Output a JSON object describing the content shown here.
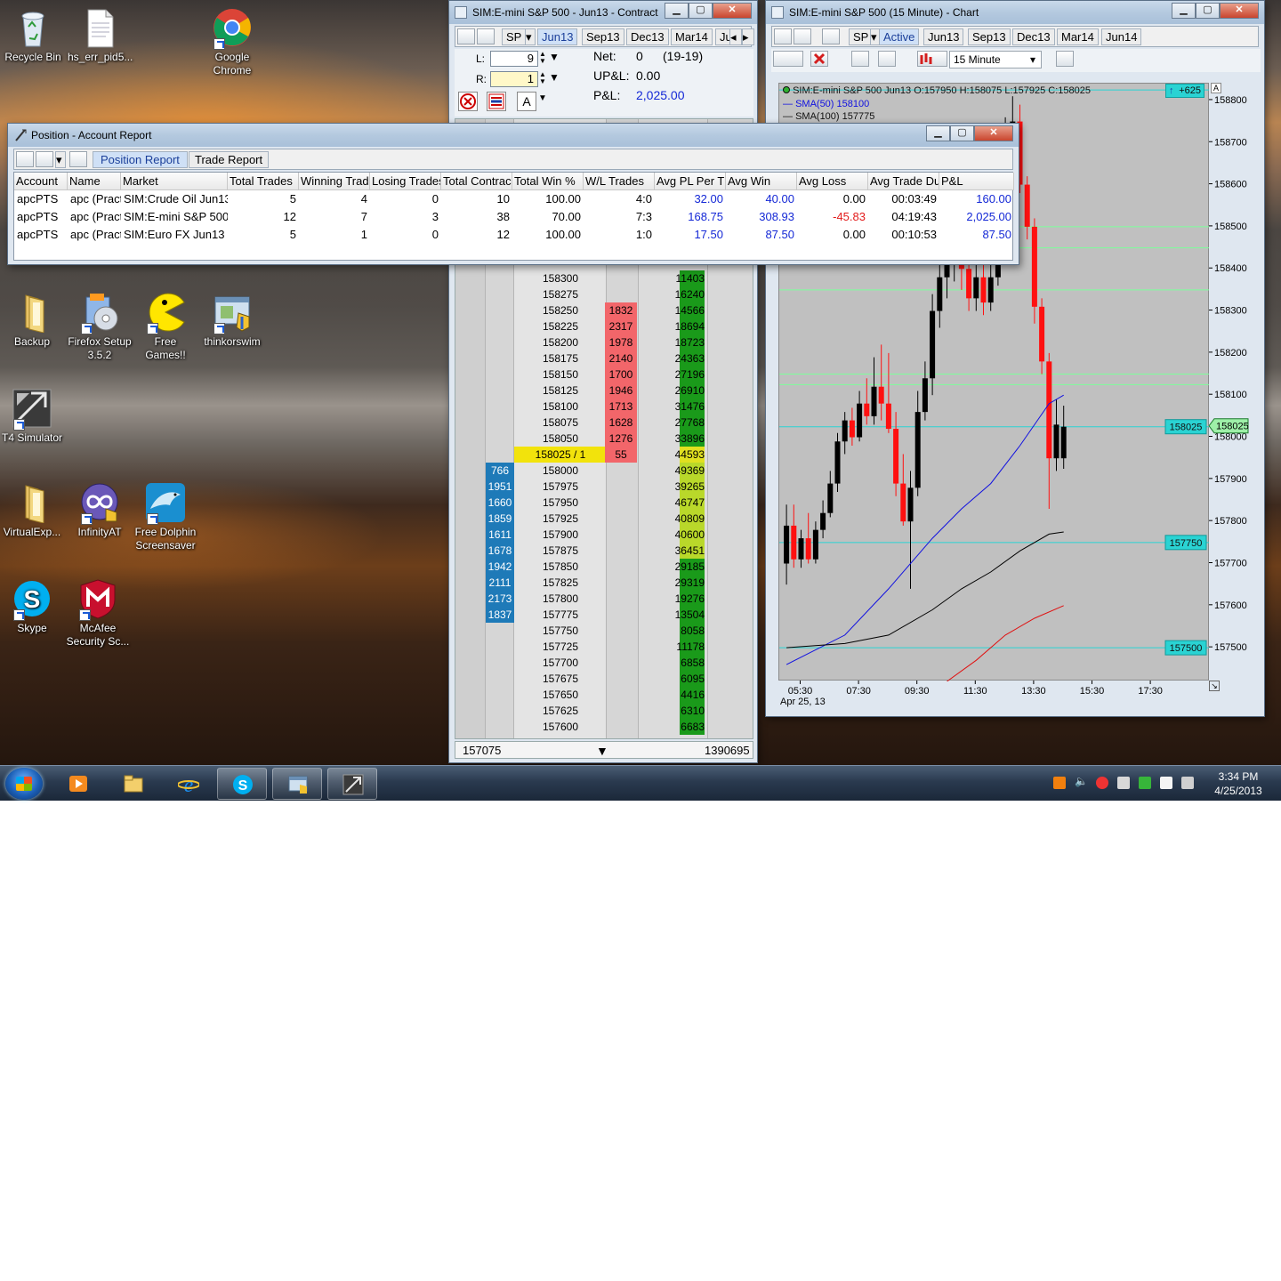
{
  "desktop": {
    "icons": [
      {
        "label": "Recycle Bin",
        "icon": "recycle-bin-icon"
      },
      {
        "label": "hs_err_pid5...",
        "icon": "text-file-icon"
      },
      {
        "label": "Google\nChrome",
        "icon": "chrome-icon"
      },
      {
        "label": "Backup",
        "icon": "folder-icon"
      },
      {
        "label": "Firefox Setup\n3.5.2",
        "icon": "installer-icon"
      },
      {
        "label": "Free Games!!",
        "icon": "pacman-icon"
      },
      {
        "label": "thinkorswim",
        "icon": "app-window-icon"
      },
      {
        "label": "T4 Simulator",
        "icon": "t4-icon"
      },
      {
        "label": "VirtualExp...",
        "icon": "folder-icon"
      },
      {
        "label": "InfinityAT",
        "icon": "infinity-icon"
      },
      {
        "label": "Free Dolphin\nScreensaver",
        "icon": "dolphin-icon"
      },
      {
        "label": "Skype",
        "icon": "skype-icon"
      },
      {
        "label": "McAfee\nSecurity Sc...",
        "icon": "mcafee-icon"
      }
    ]
  },
  "taskbar": {
    "apps": [
      "media-player-icon",
      "file-explorer-icon",
      "internet-explorer-icon",
      "skype-icon",
      "thinkorswim-icon",
      "t4-icon"
    ],
    "clock_time": "3:34 PM",
    "clock_date": "4/25/2013"
  },
  "contract_window": {
    "title": "SIM:E-mini S&P 500 - Jun13 - Contract",
    "symbol": "SP",
    "tabs": [
      "Jun13",
      "Sep13",
      "Dec13",
      "Mar14",
      "Ju"
    ],
    "selected_tab": "Jun13",
    "l_label": "L:",
    "l_value": "9",
    "r_label": "R:",
    "r_value": "1",
    "net_label": "Net:",
    "net_value": "0",
    "net_range": "(19-19)",
    "upl_label": "UP&L:",
    "upl_value": "0.00",
    "pl_label": "P&L:",
    "pl_value": "2,025.00",
    "footer_left": "157075",
    "footer_right": "1390695",
    "ladder": [
      {
        "price": "158300",
        "bid": "",
        "ask": "",
        "vol": "11403"
      },
      {
        "price": "158275",
        "bid": "",
        "ask": "",
        "vol": "16240"
      },
      {
        "price": "158250",
        "bid": "",
        "ask": "1832",
        "vol": "14566"
      },
      {
        "price": "158225",
        "bid": "",
        "ask": "2317",
        "vol": "18694"
      },
      {
        "price": "158200",
        "bid": "",
        "ask": "1978",
        "vol": "18723"
      },
      {
        "price": "158175",
        "bid": "",
        "ask": "2140",
        "vol": "24363"
      },
      {
        "price": "158150",
        "bid": "",
        "ask": "1700",
        "vol": "27196"
      },
      {
        "price": "158125",
        "bid": "",
        "ask": "1946",
        "vol": "26910"
      },
      {
        "price": "158100",
        "bid": "",
        "ask": "1713",
        "vol": "31476"
      },
      {
        "price": "158075",
        "bid": "",
        "ask": "1628",
        "vol": "27768"
      },
      {
        "price": "158050",
        "bid": "",
        "ask": "1276",
        "vol": "33896"
      },
      {
        "price": "158025 / 1",
        "bid": "",
        "ask": "55",
        "vol": "44593",
        "current": true
      },
      {
        "price": "158000",
        "bid": "766",
        "ask": "",
        "vol": "49369"
      },
      {
        "price": "157975",
        "bid": "1951",
        "ask": "",
        "vol": "39265"
      },
      {
        "price": "157950",
        "bid": "1660",
        "ask": "",
        "vol": "46747"
      },
      {
        "price": "157925",
        "bid": "1859",
        "ask": "",
        "vol": "40809"
      },
      {
        "price": "157900",
        "bid": "1611",
        "ask": "",
        "vol": "40600"
      },
      {
        "price": "157875",
        "bid": "1678",
        "ask": "",
        "vol": "36451"
      },
      {
        "price": "157850",
        "bid": "1942",
        "ask": "",
        "vol": "29185"
      },
      {
        "price": "157825",
        "bid": "2111",
        "ask": "",
        "vol": "29319"
      },
      {
        "price": "157800",
        "bid": "2173",
        "ask": "",
        "vol": "19276"
      },
      {
        "price": "157775",
        "bid": "1837",
        "ask": "",
        "vol": "13504"
      },
      {
        "price": "157750",
        "bid": "",
        "ask": "",
        "vol": "8058"
      },
      {
        "price": "157725",
        "bid": "",
        "ask": "",
        "vol": "11178"
      },
      {
        "price": "157700",
        "bid": "",
        "ask": "",
        "vol": "6858"
      },
      {
        "price": "157675",
        "bid": "",
        "ask": "",
        "vol": "6095"
      },
      {
        "price": "157650",
        "bid": "",
        "ask": "",
        "vol": "4416"
      },
      {
        "price": "157625",
        "bid": "",
        "ask": "",
        "vol": "6310"
      },
      {
        "price": "157600",
        "bid": "",
        "ask": "",
        "vol": "6683"
      }
    ]
  },
  "chart_window": {
    "title": "SIM:E-mini S&P 500 (15 Minute) - Chart",
    "symbol": "SP",
    "tabs": [
      "Active",
      "Jun13",
      "Sep13",
      "Dec13",
      "Mar14",
      "Jun14"
    ],
    "selected_tab": "Active",
    "interval": "15 Minute",
    "ohlc_label": "SIM:E-mini S&P 500 Jun13 O:157950 H:158075 L:157925 C:158025",
    "sma50_label": "SMA(50)  158100",
    "sma100_label": "SMA(100)  157775",
    "top_badge": "+625",
    "price_badges": [
      "158025",
      "157750",
      "157500"
    ],
    "current_price_tag": "158025",
    "date_label": "Apr 25, 13",
    "colors": {
      "up": "#000000",
      "down": "#ff1010",
      "sma50": "#1010e0",
      "sma100": "#000000",
      "sma200": "#e01010",
      "levels": "#7dff9a",
      "badge": "#2ad3d3"
    }
  },
  "chart_data": {
    "type": "candlestick",
    "x_ticks": [
      "05:30",
      "07:30",
      "09:30",
      "11:30",
      "13:30",
      "15:30",
      "17:30"
    ],
    "y_ticks": [
      "158800",
      "158700",
      "158600",
      "158500",
      "158400",
      "158300",
      "158200",
      "158100",
      "158000",
      "157900",
      "157800",
      "157700",
      "157600",
      "157500"
    ],
    "ylim": [
      157420,
      158840
    ],
    "x_start_time": "05:00",
    "bar_minutes": 15,
    "candles": [
      {
        "o": 157700,
        "h": 157840,
        "l": 157650,
        "c": 157790
      },
      {
        "o": 157790,
        "h": 157840,
        "l": 157690,
        "c": 157710
      },
      {
        "o": 157710,
        "h": 157780,
        "l": 157690,
        "c": 157760
      },
      {
        "o": 157760,
        "h": 157820,
        "l": 157700,
        "c": 157710
      },
      {
        "o": 157710,
        "h": 157800,
        "l": 157700,
        "c": 157780
      },
      {
        "o": 157780,
        "h": 157850,
        "l": 157760,
        "c": 157820
      },
      {
        "o": 157820,
        "h": 157920,
        "l": 157810,
        "c": 157890
      },
      {
        "o": 157890,
        "h": 158010,
        "l": 157870,
        "c": 157990
      },
      {
        "o": 157990,
        "h": 158060,
        "l": 157960,
        "c": 158040
      },
      {
        "o": 158040,
        "h": 158070,
        "l": 157980,
        "c": 158000
      },
      {
        "o": 158000,
        "h": 158110,
        "l": 157990,
        "c": 158080
      },
      {
        "o": 158080,
        "h": 158140,
        "l": 158030,
        "c": 158050
      },
      {
        "o": 158050,
        "h": 158190,
        "l": 158030,
        "c": 158120
      },
      {
        "o": 158120,
        "h": 158220,
        "l": 158040,
        "c": 158080
      },
      {
        "o": 158080,
        "h": 158200,
        "l": 158010,
        "c": 158020
      },
      {
        "o": 158020,
        "h": 158060,
        "l": 157860,
        "c": 157890
      },
      {
        "o": 157890,
        "h": 157960,
        "l": 157790,
        "c": 157800
      },
      {
        "o": 157800,
        "h": 157920,
        "l": 157640,
        "c": 157880
      },
      {
        "o": 157880,
        "h": 158110,
        "l": 157860,
        "c": 158060
      },
      {
        "o": 158060,
        "h": 158180,
        "l": 158040,
        "c": 158140
      },
      {
        "o": 158140,
        "h": 158340,
        "l": 158100,
        "c": 158300
      },
      {
        "o": 158300,
        "h": 158420,
        "l": 158260,
        "c": 158380
      },
      {
        "o": 158380,
        "h": 158450,
        "l": 158330,
        "c": 158410
      },
      {
        "o": 158410,
        "h": 158460,
        "l": 158370,
        "c": 158420
      },
      {
        "o": 158420,
        "h": 158440,
        "l": 158350,
        "c": 158400
      },
      {
        "o": 158400,
        "h": 158440,
        "l": 158300,
        "c": 158330
      },
      {
        "o": 158330,
        "h": 158420,
        "l": 158300,
        "c": 158380
      },
      {
        "o": 158380,
        "h": 158430,
        "l": 158290,
        "c": 158320
      },
      {
        "o": 158320,
        "h": 158420,
        "l": 158300,
        "c": 158380
      },
      {
        "o": 158380,
        "h": 158650,
        "l": 158360,
        "c": 158620
      },
      {
        "o": 158620,
        "h": 158760,
        "l": 158580,
        "c": 158700
      },
      {
        "o": 158700,
        "h": 158810,
        "l": 158650,
        "c": 158750
      },
      {
        "o": 158750,
        "h": 158790,
        "l": 158580,
        "c": 158600
      },
      {
        "o": 158600,
        "h": 158620,
        "l": 158470,
        "c": 158500
      },
      {
        "o": 158500,
        "h": 158520,
        "l": 158270,
        "c": 158310
      },
      {
        "o": 158310,
        "h": 158330,
        "l": 158150,
        "c": 158180
      },
      {
        "o": 158180,
        "h": 158200,
        "l": 157830,
        "c": 157950
      },
      {
        "o": 157950,
        "h": 158090,
        "l": 157920,
        "c": 158030
      },
      {
        "o": 157950,
        "h": 158075,
        "l": 157925,
        "c": 158025
      }
    ],
    "series": [
      {
        "name": "SMA(50)",
        "color": "#1010e0",
        "values": [
          [
            0,
            157460
          ],
          [
            8,
            157530
          ],
          [
            14,
            157640
          ],
          [
            20,
            157760
          ],
          [
            24,
            157830
          ],
          [
            28,
            157890
          ],
          [
            32,
            157980
          ],
          [
            36,
            158080
          ],
          [
            38,
            158100
          ]
        ]
      },
      {
        "name": "SMA(100)",
        "color": "#000000",
        "values": [
          [
            0,
            157500
          ],
          [
            8,
            157510
          ],
          [
            14,
            157530
          ],
          [
            20,
            157590
          ],
          [
            24,
            157640
          ],
          [
            28,
            157680
          ],
          [
            32,
            157730
          ],
          [
            36,
            157770
          ],
          [
            38,
            157775
          ]
        ]
      },
      {
        "name": "SMA(200)",
        "color": "#e01010",
        "values": [
          [
            22,
            157420
          ],
          [
            26,
            157470
          ],
          [
            30,
            157530
          ],
          [
            34,
            157570
          ],
          [
            38,
            157600
          ]
        ]
      }
    ],
    "horizontal_lines": [
      {
        "y": 158825,
        "color": "#2ad3d3"
      },
      {
        "y": 158500,
        "color": "#7dff9a"
      },
      {
        "y": 158450,
        "color": "#7dff9a"
      },
      {
        "y": 158350,
        "color": "#7dff9a"
      },
      {
        "y": 158150,
        "color": "#7dff9a"
      },
      {
        "y": 158125,
        "color": "#7dff9a"
      },
      {
        "y": 158025,
        "color": "#2ad3d3"
      },
      {
        "y": 157750,
        "color": "#2ad3d3"
      },
      {
        "y": 157500,
        "color": "#2ad3d3"
      }
    ]
  },
  "report_window": {
    "title": "Position - Account Report",
    "tabs": [
      "Position Report",
      "Trade Report"
    ],
    "selected_tab": "Position Report",
    "columns": [
      "Account",
      "Name",
      "Market",
      "Total Trades",
      "Winning Trad",
      "Losing Trades",
      "Total Contrac",
      "Total Win %",
      "W/L Trades",
      "Avg PL Per T",
      "Avg Win",
      "Avg Loss",
      "Avg Trade Du",
      "P&L"
    ],
    "rows": [
      [
        "apcPTS",
        "apc (Pract",
        "SIM:Crude Oil Jun13",
        "5",
        "4",
        "0",
        "10",
        "100.00",
        "4:0",
        "32.00",
        "40.00",
        "0.00",
        "00:03:49",
        "160.00"
      ],
      [
        "apcPTS",
        "apc (Pract",
        "SIM:E-mini S&P 500",
        "12",
        "7",
        "3",
        "38",
        "70.00",
        "7:3",
        "168.75",
        "308.93",
        "-45.83",
        "04:19:43",
        "2,025.00"
      ],
      [
        "apcPTS",
        "apc (Pract",
        "SIM:Euro FX Jun13",
        "5",
        "1",
        "0",
        "12",
        "100.00",
        "1:0",
        "17.50",
        "87.50",
        "0.00",
        "00:10:53",
        "87.50"
      ]
    ]
  }
}
